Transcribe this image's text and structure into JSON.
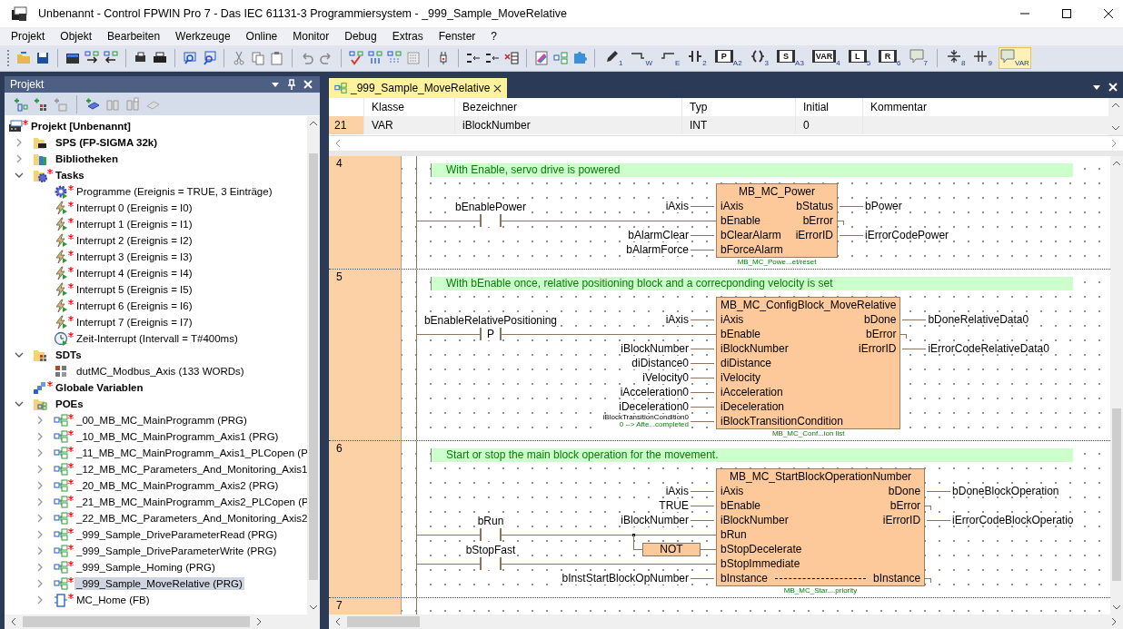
{
  "window": {
    "title": "Unbenannt - Control FPWIN Pro 7 - Das IEC 61131-3 Programmiersystem - _999_Sample_MoveRelative"
  },
  "menu": [
    "Projekt",
    "Objekt",
    "Bearbeiten",
    "Werkzeuge",
    "Online",
    "Monitor",
    "Debug",
    "Extras",
    "Fenster",
    "?"
  ],
  "ladder_tools": [
    {
      "kind": "pencil",
      "key": "1",
      "selected": false
    },
    {
      "kind": "wire-w",
      "key": "W",
      "selected": false
    },
    {
      "kind": "wire-e",
      "key": "E",
      "selected": false
    },
    {
      "kind": "contact",
      "key": "2",
      "selected": false
    },
    {
      "kind": "contact",
      "glyph": "P",
      "key": "A2",
      "selected": false
    },
    {
      "kind": "coil",
      "key": "3",
      "selected": false
    },
    {
      "kind": "coil",
      "glyph": "S",
      "key": "A3",
      "selected": false
    },
    {
      "kind": "box",
      "glyph": "VAR",
      "key": "4",
      "selected": false
    },
    {
      "kind": "jump",
      "glyph": "L",
      "key": "5",
      "selected": false
    },
    {
      "kind": "jump",
      "glyph": "R",
      "key": "6",
      "selected": false
    },
    {
      "kind": "comment",
      "key": "7",
      "selected": false
    },
    {
      "kind": "vsplit",
      "key": "8",
      "selected": false
    },
    {
      "kind": "hsplit",
      "key": "9",
      "selected": false
    },
    {
      "kind": "comment",
      "key": "VAR",
      "selected": true
    }
  ],
  "project_panel": {
    "title": "Projekt",
    "tree": {
      "label": "Projekt [Unbenannt]",
      "kind": "project",
      "modified": true,
      "selected": false,
      "children": [
        {
          "label": "SPS (FP-SIGMA 32k)",
          "kind": "folder-plc",
          "modified": false,
          "expanded": false,
          "selected": false
        },
        {
          "label": "Bibliotheken",
          "kind": "folder-lib",
          "modified": false,
          "expanded": false,
          "selected": false
        },
        {
          "label": "Tasks",
          "kind": "folder-tasks",
          "modified": true,
          "expanded": true,
          "selected": false,
          "children": [
            {
              "label": "Programme (Ereignis = TRUE, 3 Einträge)",
              "kind": "task",
              "modified": true,
              "selected": false
            },
            {
              "label": "Interrupt 0 (Ereignis = I0)",
              "kind": "interrupt",
              "modified": true,
              "selected": false
            },
            {
              "label": "Interrupt 1 (Ereignis = I1)",
              "kind": "interrupt",
              "modified": true,
              "selected": false
            },
            {
              "label": "Interrupt 2 (Ereignis = I2)",
              "kind": "interrupt",
              "modified": true,
              "selected": false
            },
            {
              "label": "Interrupt 3 (Ereignis = I3)",
              "kind": "interrupt",
              "modified": true,
              "selected": false
            },
            {
              "label": "Interrupt 4 (Ereignis = I4)",
              "kind": "interrupt",
              "modified": true,
              "selected": false
            },
            {
              "label": "Interrupt 5 (Ereignis = I5)",
              "kind": "interrupt",
              "modified": true,
              "selected": false
            },
            {
              "label": "Interrupt 6 (Ereignis = I6)",
              "kind": "interrupt",
              "modified": true,
              "selected": false
            },
            {
              "label": "Interrupt 7 (Ereignis = I7)",
              "kind": "interrupt",
              "modified": true,
              "selected": false
            },
            {
              "label": "Zeit-Interrupt (Intervall = T#400ms)",
              "kind": "timer",
              "modified": true,
              "selected": false
            }
          ]
        },
        {
          "label": "SDTs",
          "kind": "folder-sdt",
          "modified": false,
          "expanded": true,
          "selected": false,
          "children": [
            {
              "label": "dutMC_Modbus_Axis (133 WORDs)",
              "kind": "dut",
              "modified": false,
              "selected": false
            }
          ]
        },
        {
          "label": "Globale Variablen",
          "kind": "globals",
          "modified": true,
          "selected": false
        },
        {
          "label": "POEs",
          "kind": "folder-poe",
          "modified": false,
          "expanded": true,
          "selected": false,
          "children": [
            {
              "label": "_00_MB_MC_MainProgramm (PRG)",
              "kind": "prg",
              "modified": true,
              "expanded": false,
              "selected": false
            },
            {
              "label": "_10_MB_MC_MainProgramm_Axis1 (PRG)",
              "kind": "prg",
              "modified": true,
              "expanded": false,
              "selected": false
            },
            {
              "label": "_11_MB_MC_MainProgramm_Axis1_PLCopen (P",
              "kind": "prg",
              "modified": true,
              "expanded": false,
              "selected": false
            },
            {
              "label": "_12_MB_MC_Parameters_And_Monitoring_Axis1",
              "kind": "prg",
              "modified": true,
              "expanded": false,
              "selected": false
            },
            {
              "label": "_20_MB_MC_MainProgramm_Axis2 (PRG)",
              "kind": "prg",
              "modified": true,
              "expanded": false,
              "selected": false
            },
            {
              "label": "_21_MB_MC_MainProgramm_Axis2_PLCopen (P",
              "kind": "prg",
              "modified": true,
              "expanded": false,
              "selected": false
            },
            {
              "label": "_22_MB_MC_Parameters_And_Monitoring_Axis2",
              "kind": "prg",
              "modified": true,
              "expanded": false,
              "selected": false
            },
            {
              "label": "_999_Sample_DriveParameterRead (PRG)",
              "kind": "prg",
              "modified": true,
              "expanded": false,
              "selected": false
            },
            {
              "label": "_999_Sample_DriveParameterWrite (PRG)",
              "kind": "prg",
              "modified": true,
              "expanded": false,
              "selected": false
            },
            {
              "label": "_999_Sample_Homing (PRG)",
              "kind": "prg",
              "modified": true,
              "expanded": false,
              "selected": false
            },
            {
              "label": "_999_Sample_MoveRelative (PRG)",
              "kind": "prg",
              "modified": true,
              "expanded": false,
              "selected": true
            },
            {
              "label": "MC_Home (FB)",
              "kind": "fb",
              "modified": true,
              "expanded": false,
              "selected": false
            }
          ]
        }
      ]
    }
  },
  "editor": {
    "tab": {
      "label": "_999_Sample_MoveRelative",
      "selected": true
    },
    "var_table": {
      "columns": [
        "Klasse",
        "Bezeichner",
        "Typ",
        "Initial",
        "Kommentar"
      ],
      "rows": [
        {
          "number": "21",
          "cells": [
            "VAR",
            "iBlockNumber",
            "INT",
            "0"
          ]
        }
      ]
    },
    "networks": [
      {
        "number": "4",
        "comment": "With Enable, servo drive is powered",
        "block": {
          "name": "MB_MC_Power",
          "footer": "MB_MC_Powe...et/reset",
          "inputs": [
            {
              "pin": "iAxis",
              "var": "iAxis"
            },
            {
              "pin": "bEnable",
              "contact": {
                "label": "bEnablePower"
              }
            },
            {
              "pin": "bClearAlarm",
              "var": "bAlarmClear"
            },
            {
              "pin": "bForceAlarm",
              "var": "bAlarmForce"
            }
          ],
          "outputs": [
            {
              "pin": "bStatus",
              "var": "bPower",
              "kind": "normal"
            },
            {
              "pin": "bError",
              "kind": "normal"
            },
            {
              "pin": "iErrorID",
              "var": "iErrorCodePower",
              "kind": "normal"
            }
          ]
        }
      },
      {
        "number": "5",
        "comment": "With bEnable once, relative positioning block and a correcponding velocity is set",
        "block": {
          "name": "MB_MC_ConfigBlock_MoveRelative",
          "footer": "MB_MC_Conf...ion list",
          "inputs": [
            {
              "pin": "iAxis",
              "var": "iAxis"
            },
            {
              "pin": "bEnable",
              "contact": {
                "label": "bEnableRelativePositioning",
                "symbol": "P"
              }
            },
            {
              "pin": "iBlockNumber",
              "var": "iBlockNumber"
            },
            {
              "pin": "diDistance",
              "var": "diDistance0"
            },
            {
              "pin": "iVelocity",
              "var": "iVelocity0"
            },
            {
              "pin": "iAcceleration",
              "var": "iAcceleration0"
            },
            {
              "pin": "iDeceleration",
              "var": "iDeceleration0"
            },
            {
              "pin": "iBlockTransitionCondition",
              "var": "iBlockTransitionCondition0",
              "note": "0 --> Afte...completed"
            }
          ],
          "outputs": [
            {
              "pin": "bDone",
              "var": "bDoneRelativeData0",
              "kind": "normal"
            },
            {
              "pin": "bError",
              "kind": "normal"
            },
            {
              "pin": "iErrorID",
              "var": "iErrorCodeRelativeData0",
              "kind": "normal"
            }
          ]
        }
      },
      {
        "number": "6",
        "comment": "Start or stop the main block operation for the movement.",
        "block": {
          "name": "MB_MC_StartBlockOperationNumber",
          "footer": "MB_MC_Star....priority",
          "inputs": [
            {
              "pin": "iAxis",
              "var": "iAxis"
            },
            {
              "pin": "bEnable",
              "var": "TRUE"
            },
            {
              "pin": "iBlockNumber",
              "var": "iBlockNumber"
            },
            {
              "pin": "bRun",
              "contact": {
                "label": "bRun"
              }
            },
            {
              "pin": "bStopDecelerate",
              "gate": "NOT"
            },
            {
              "pin": "bStopImmediate",
              "contact": {
                "label": "bStopFast"
              }
            },
            {
              "pin": "bInstance",
              "var": "bInstStartBlockOpNumber"
            }
          ],
          "outputs": [
            {
              "pin": "bDone",
              "var": "bDoneBlockOperation",
              "kind": "normal"
            },
            {
              "pin": "bError",
              "kind": "normal"
            },
            {
              "pin": "iErrorID",
              "var": "iErrorCodeBlockOperatio",
              "kind": "normal"
            },
            {
              "pin": "bInstance",
              "kind": "instance"
            }
          ]
        }
      },
      {
        "number": "7"
      }
    ]
  }
}
